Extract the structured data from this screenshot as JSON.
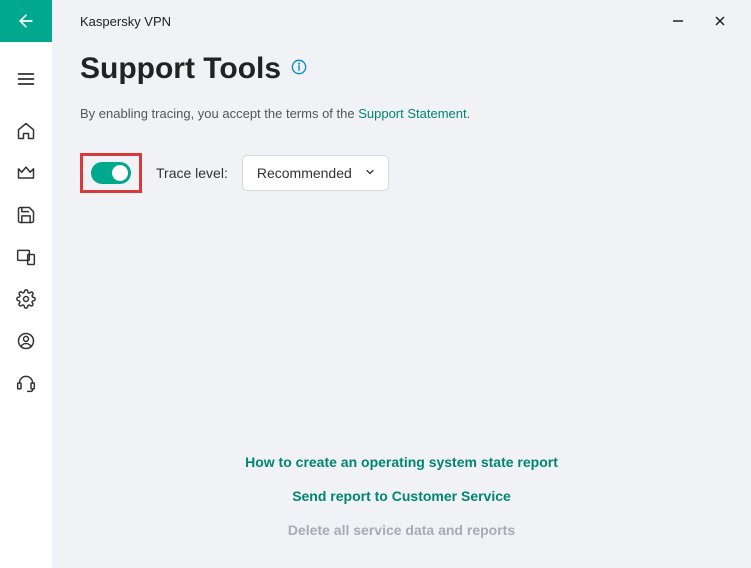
{
  "titlebar": {
    "app_name": "Kaspersky VPN"
  },
  "page": {
    "title": "Support Tools",
    "notice_prefix": "By enabling tracing, you accept the terms of the ",
    "notice_link": "Support Statement",
    "notice_suffix": "."
  },
  "trace": {
    "label": "Trace level:",
    "selected": "Recommended",
    "enabled": true
  },
  "footer": {
    "link_report": "How to create an operating system state report",
    "link_send": "Send report to Customer Service",
    "link_delete": "Delete all service data and reports"
  }
}
